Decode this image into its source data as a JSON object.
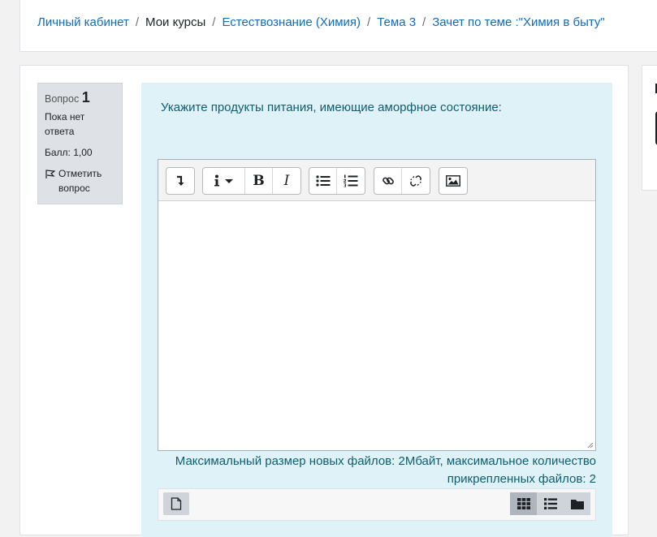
{
  "breadcrumb": {
    "items": [
      {
        "label": "Личный кабинет",
        "link": true
      },
      {
        "label": "Мои курсы",
        "link": false
      },
      {
        "label": "Естествознание (Химия)",
        "link": true
      },
      {
        "label": "Тема 3",
        "link": true
      },
      {
        "label": "Зачет по теме :\"Химия в быту\"",
        "link": true
      }
    ],
    "separator": "/"
  },
  "question_info": {
    "question_word": "Вопрос",
    "number": "1",
    "status": "Пока нет ответа",
    "grade": "Балл: 1,00",
    "flag_label": "Отметить вопрос"
  },
  "question": {
    "text": "Укажите продукты питания, имеющие аморфное состояние:"
  },
  "editor": {
    "value": "",
    "toolbar_icons": [
      "toolbar-toggle-icon",
      "info-dropdown-icon",
      "bold-icon",
      "italic-icon",
      "unordered-list-icon",
      "ordered-list-icon",
      "link-icon",
      "unlink-icon",
      "image-icon"
    ]
  },
  "file_info": {
    "text": "Максимальный размер новых файлов: 2Мбайт, максимальное количество прикрепленных файлов: 2"
  },
  "filepicker": {
    "icons": [
      "add-file-icon",
      "grid-view-icon",
      "list-view-icon",
      "folder-view-icon"
    ],
    "active_view": "grid-view-icon"
  },
  "colors": {
    "link": "#0f6cbf",
    "question_bg": "#def2f8",
    "question_text": "#0f5d6f",
    "info_bg": "#dee2e6"
  }
}
